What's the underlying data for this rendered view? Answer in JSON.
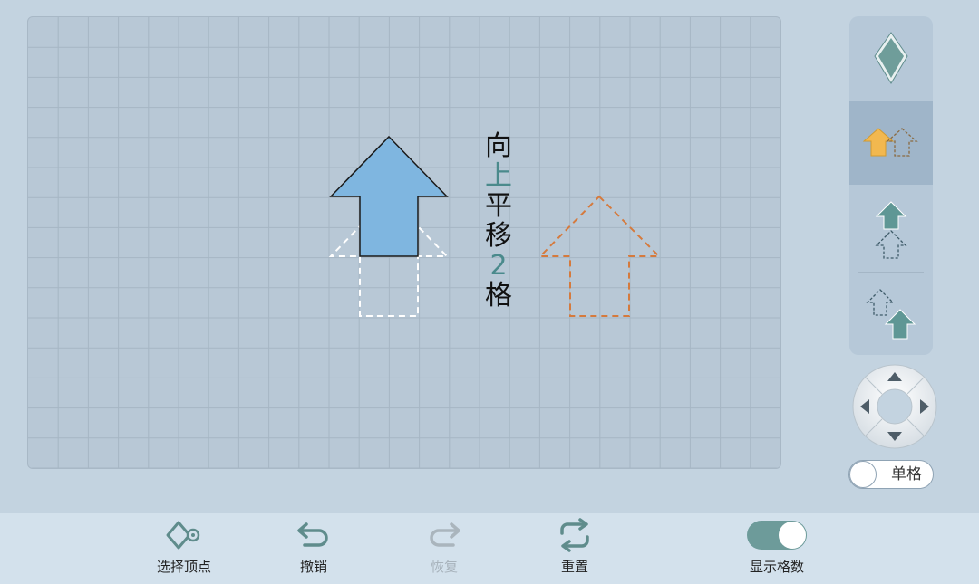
{
  "canvas": {
    "caption_chars": [
      {
        "text": "向",
        "color": "#111111"
      },
      {
        "text": "上",
        "color": "#4a8a8c"
      },
      {
        "text": "平",
        "color": "#111111"
      },
      {
        "text": "移",
        "color": "#111111"
      },
      {
        "text": "2",
        "color": "#4a8a8c"
      },
      {
        "text": "格",
        "color": "#111111"
      }
    ]
  },
  "shape_modes": [
    {
      "name": "rhombus-shape",
      "icon": "rhombus-icon"
    },
    {
      "name": "translate-horizontal",
      "icon": "arrow-translate-horizontal-icon",
      "active": true
    },
    {
      "name": "translate-vertical",
      "icon": "arrow-translate-vertical-icon"
    },
    {
      "name": "translate-diagonal",
      "icon": "arrow-translate-diagonal-icon"
    }
  ],
  "unit_toggle": {
    "label": "单格",
    "on": false
  },
  "toolbar": {
    "select_vertex": "选择顶点",
    "undo": "撤销",
    "redo": "恢复",
    "reset": "重置",
    "show_grid_count": "显示格数",
    "show_grid_count_on": true
  },
  "colors": {
    "arrow_fill": "#7fb6e0",
    "original_outline": "#ffffff",
    "target_outline": "#d57a3d",
    "accent": "#6d9b9a"
  }
}
